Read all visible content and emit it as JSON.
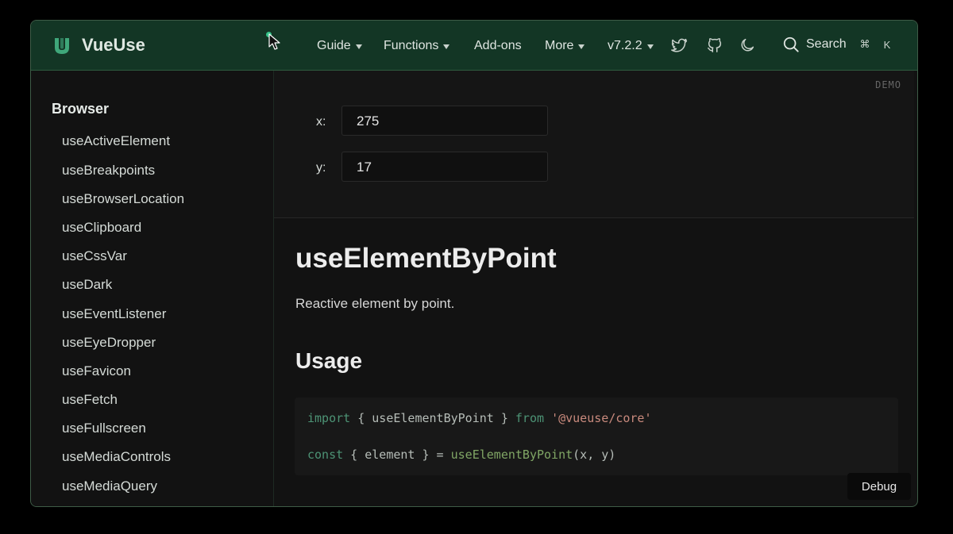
{
  "navbar": {
    "brand": "VueUse",
    "items": [
      {
        "label": "Guide",
        "dropdown": true
      },
      {
        "label": "Functions",
        "dropdown": true
      },
      {
        "label": "Add-ons",
        "dropdown": false
      },
      {
        "label": "More",
        "dropdown": true
      },
      {
        "label": "v7.2.2",
        "dropdown": true
      }
    ],
    "icons": [
      "twitter-icon",
      "github-icon",
      "moon-icon"
    ],
    "search_label": "Search",
    "shortcut_symbol": "⌘",
    "shortcut_key": "K"
  },
  "sidebar": {
    "section_title": "Browser",
    "items": [
      "useActiveElement",
      "useBreakpoints",
      "useBrowserLocation",
      "useClipboard",
      "useCssVar",
      "useDark",
      "useEventListener",
      "useEyeDropper",
      "useFavicon",
      "useFetch",
      "useFullscreen",
      "useMediaControls",
      "useMediaQuery"
    ]
  },
  "demo": {
    "tag": "DEMO",
    "x_label": "x:",
    "x_value": "275",
    "y_label": "y:",
    "y_value": "17"
  },
  "main": {
    "title": "useElementByPoint",
    "description": "Reactive element by point.",
    "usage_heading": "Usage",
    "code": {
      "line1": {
        "k1": "import",
        "t1": " { useElementByPoint } ",
        "k2": "from",
        "sp": " ",
        "s1": "'@vueuse/core'"
      },
      "line2": {
        "k1": "const",
        "t1": " { element } = ",
        "f1": "useElementByPoint",
        "t2": "(x, y)"
      }
    }
  },
  "debug_label": "Debug",
  "colors": {
    "accent": "#36c48a",
    "navbar_bg": "#133625",
    "keyword": "#4d9375",
    "string": "#c98a7d",
    "function": "#80a665"
  }
}
